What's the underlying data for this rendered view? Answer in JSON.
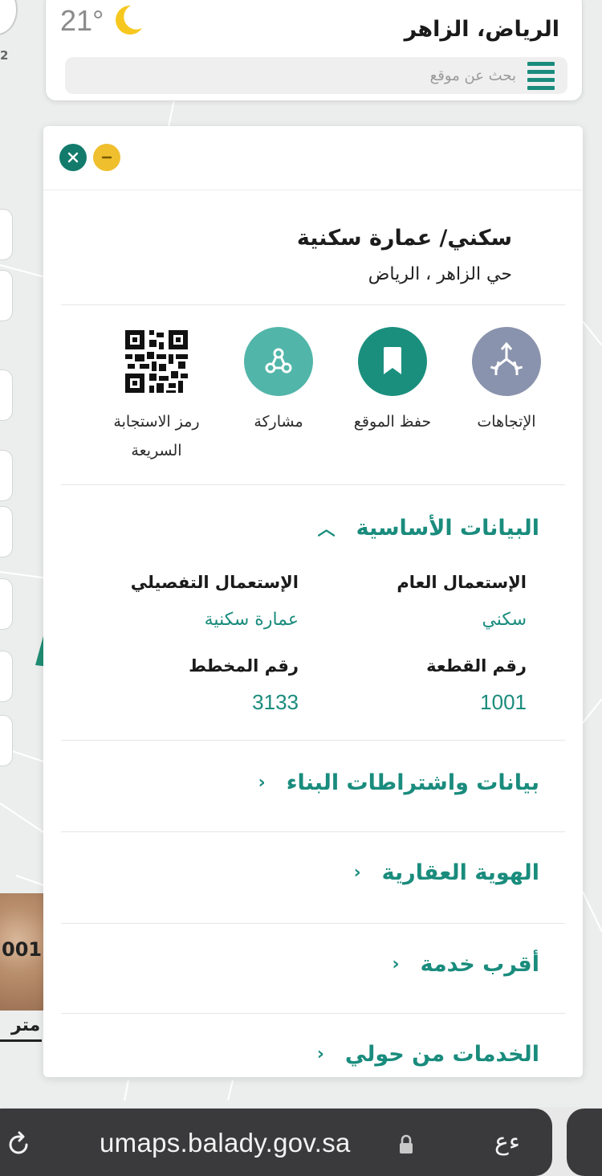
{
  "location": {
    "title": "الرياض، الزاهر",
    "temperature": "21°",
    "search_placeholder": "بحث عن موقع"
  },
  "panel": {
    "title": "سكني/ عمارة سكنية",
    "subtitle": "حي الزاهر ، الرياض",
    "actions": [
      {
        "label": "الإتجاهات",
        "icon": "directions-icon",
        "color": "#8a93ad"
      },
      {
        "label": "حفظ الموقع",
        "icon": "bookmark-icon",
        "color": "#1b8f7e"
      },
      {
        "label": "مشاركة",
        "icon": "share-icon",
        "color": "#52b5a9"
      },
      {
        "label": "رمز الاستجابة السريعة",
        "icon": "qr-code-icon"
      }
    ],
    "basic": {
      "title": "البيانات الأساسية",
      "general_use_label": "الإستعمال العام",
      "general_use_value": "سكني",
      "detailed_use_label": "الإستعمال التفصيلي",
      "detailed_use_value": "عمارة سكنية",
      "plot_label": "رقم القطعة",
      "plot_value": "1001",
      "plan_label": "رقم المخطط",
      "plan_value": "3133"
    },
    "sections": [
      {
        "title": "بيانات واشتراطات البناء"
      },
      {
        "title": "الهوية العقارية"
      },
      {
        "title": "أقرب خدمة"
      },
      {
        "title": "الخدمات من حولي"
      }
    ]
  },
  "map": {
    "plot_label": "001",
    "unit": "متر"
  },
  "browser": {
    "url": "umaps.balady.gov.sa",
    "text_size_button": "ءع"
  },
  "colors": {
    "accent": "#1a8c7d",
    "minimize": "#efbf2e",
    "close": "#127b6c"
  }
}
